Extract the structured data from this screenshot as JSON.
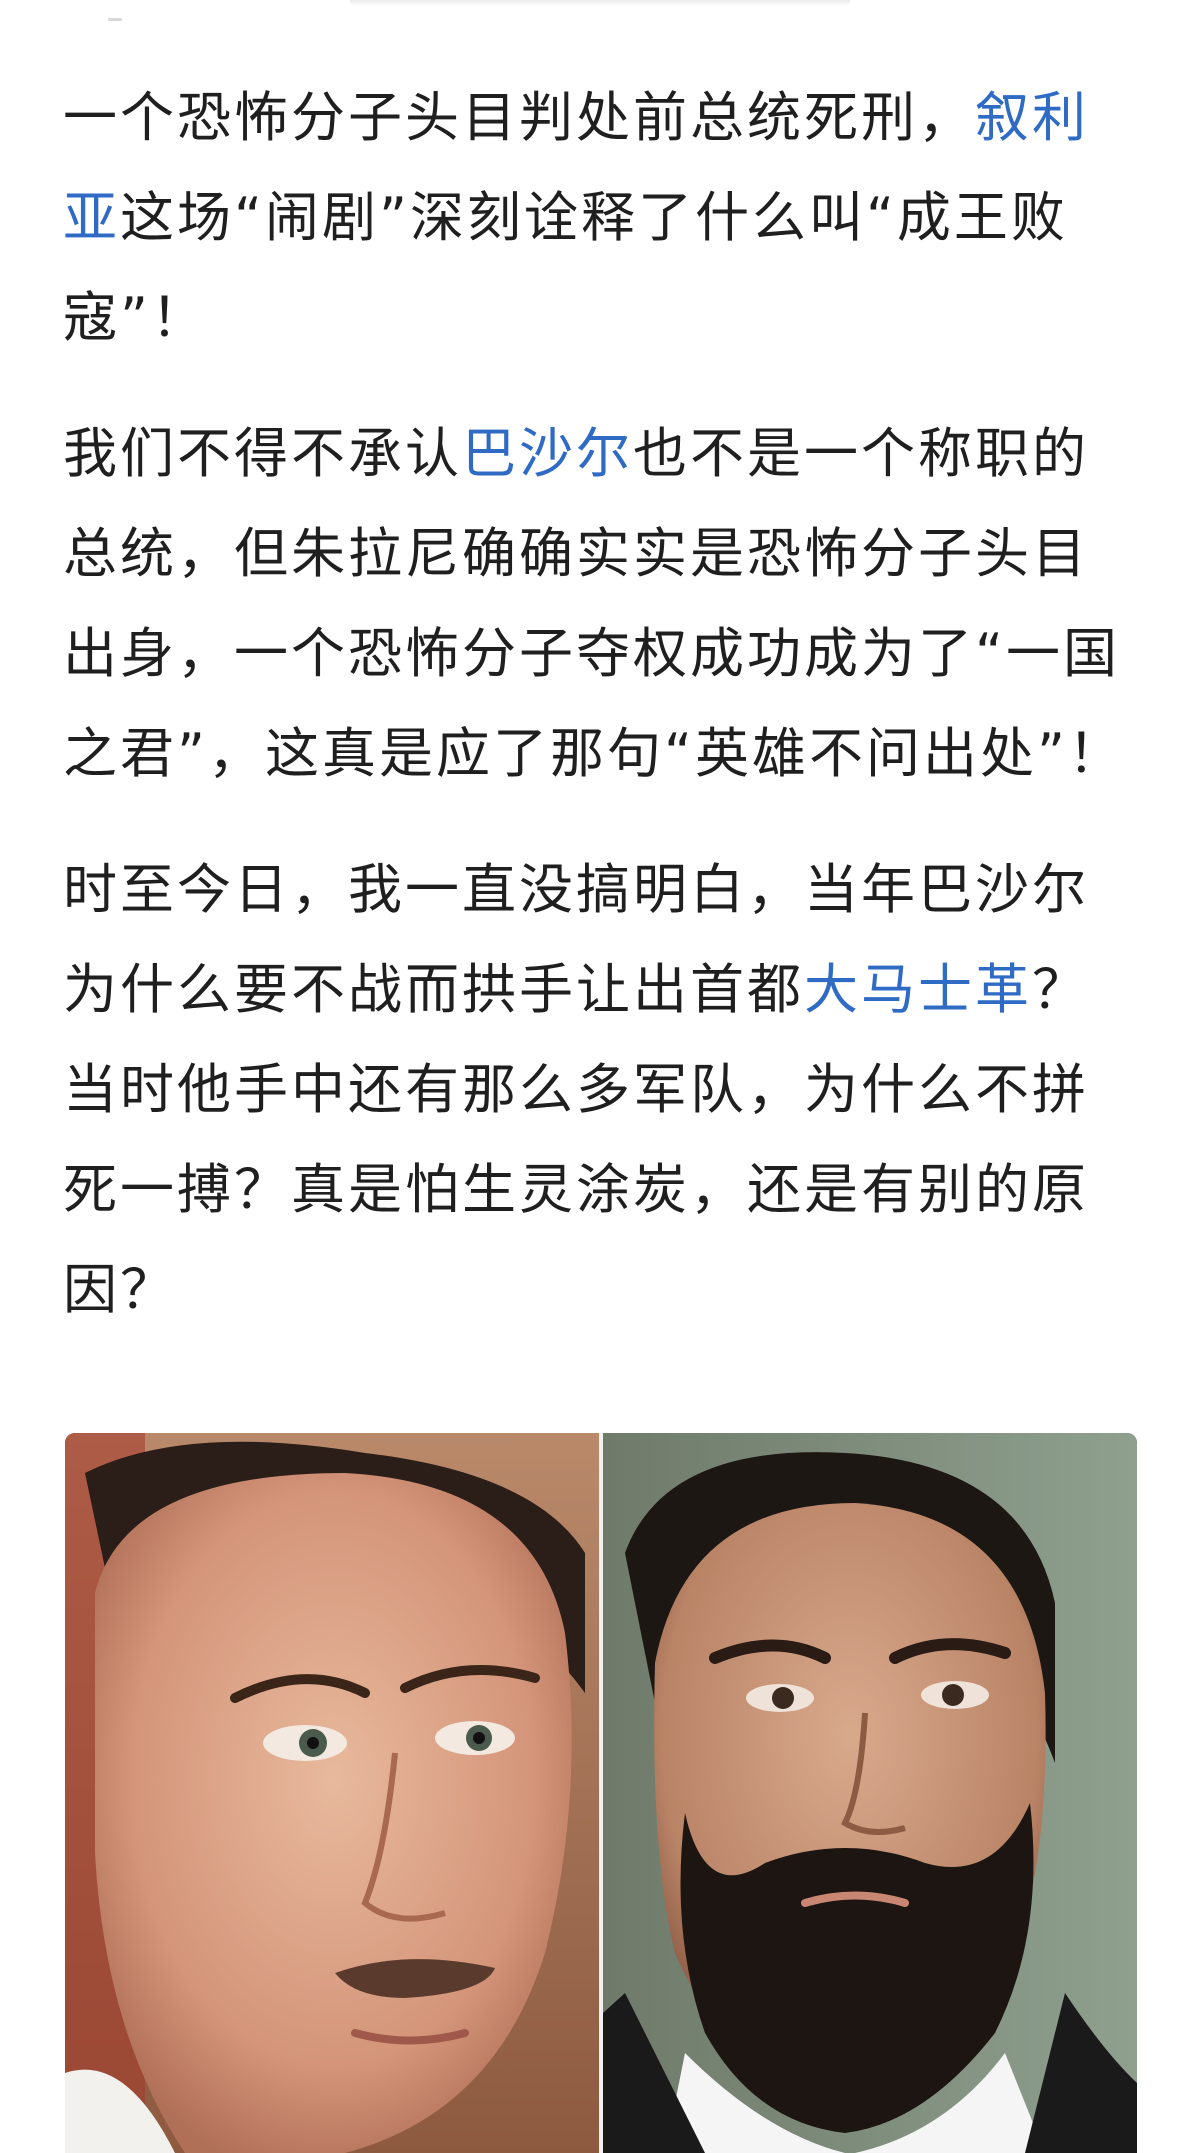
{
  "article": {
    "paragraphs": [
      {
        "segments": [
          {
            "text": "一个恐怖分子头目判处前总统死刑，",
            "link": false
          },
          {
            "text": "叙利亚",
            "link": true
          },
          {
            "text": "这场“闹剧”深刻诠释了什么叫“成王败寇”！",
            "link": false
          }
        ]
      },
      {
        "segments": [
          {
            "text": "我们不得不承认",
            "link": false
          },
          {
            "text": "巴沙尔",
            "link": true
          },
          {
            "text": "也不是一个称职的总统，但朱拉尼确确实实是恐怖分子头目出身，一个恐怖分子夺权成功成为了“一国之君”，这真是应了那句“英雄不问出处”！",
            "link": false
          }
        ]
      },
      {
        "segments": [
          {
            "text": "时至今日，我一直没搞明白，当年巴沙尔为什么要不战而拱手让出首都",
            "link": false
          },
          {
            "text": "大马士革",
            "link": true
          },
          {
            "text": "？当时他手中还有那么多军队，为什么不拼死一搏？真是怕生灵涂炭，还是有别的原因？",
            "link": false
          }
        ]
      }
    ]
  },
  "image": {
    "icon": "portrait-photo-icon"
  },
  "colors": {
    "link": "#2f6bc4",
    "text": "#1f1f1f",
    "background": "#ffffff"
  }
}
